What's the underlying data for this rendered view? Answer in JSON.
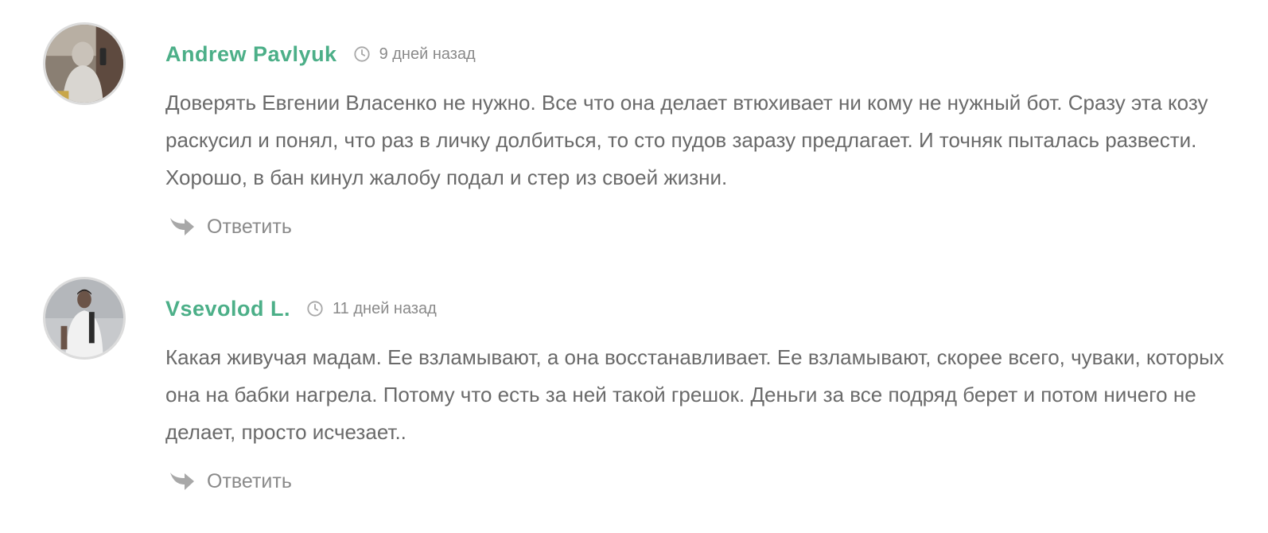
{
  "comments": [
    {
      "author": "Andrew Pavlyuk",
      "time": "9 дней назад",
      "text": "Доверять Евгении Власенко не нужно. Все что она делает втюхивает ни кому не нужный бот. Сразу эта козу раскусил и понял, что раз в личку долбиться, то сто пудов заразу предлагает. И точняк пыталась развести. Хорошо, в бан кинул жалобу подал и стер из своей жизни.",
      "reply_label": "Ответить"
    },
    {
      "author": "Vsevolod L.",
      "time": "11 дней назад",
      "text": "Какая живучая мадам. Ее взламывают, а она восстанавливает. Ее взламывают, скорее всего, чуваки, которых она на бабки нагрела. Потому что есть за ней такой грешок. Деньги за все подряд берет и потом ничего не делает, просто исчезает..",
      "reply_label": "Ответить"
    }
  ],
  "icons": {
    "time": "clock-icon",
    "reply": "reply-arrow-icon"
  },
  "colors": {
    "author": "#4caf88",
    "text": "#6a6a6a",
    "meta": "#8a8a8a",
    "icon": "#a8a8a8"
  }
}
